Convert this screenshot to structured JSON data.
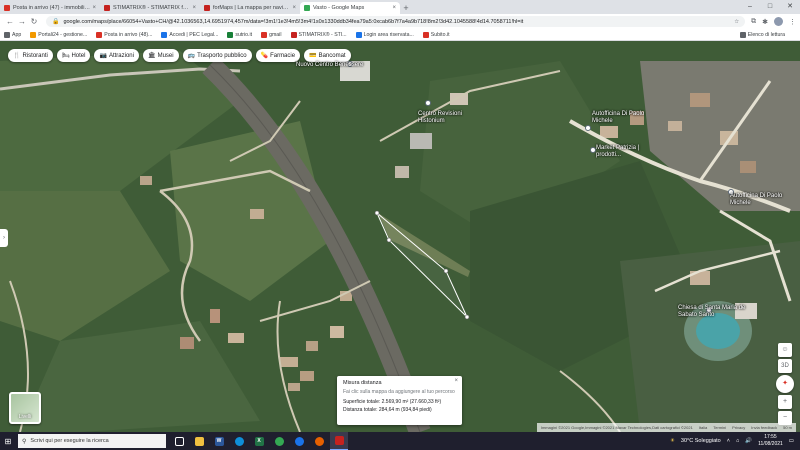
{
  "browser": {
    "tabs": [
      {
        "title": "Posta in arrivo (47) - immobiliare",
        "color": "#d93025"
      },
      {
        "title": "STIMATRIX® - STIMATRIX forMaps",
        "color": "#c5221f"
      },
      {
        "title": "forMaps | La mappa per navigare",
        "color": "#c5221f"
      },
      {
        "title": "Vasto - Google Maps",
        "color": "#34a853",
        "active": true
      }
    ],
    "new_tab": "+",
    "url": "google.com/maps/place/66054+Vasto+CH/@42.1036563,14.6951974,457m/data=!3m1!1e3!4m5!3m4!1s0x1330ddb34fea79a5:0xcab6b7f7a4a9b718!8m2!3d42.1045588!4d14.7058711!hl=it",
    "bookmarks": [
      {
        "label": "App",
        "color": "#5f6368"
      },
      {
        "label": "Portali24 - gestione...",
        "color": "#f29900"
      },
      {
        "label": "Posta in arrivo (48)...",
        "color": "#d93025"
      },
      {
        "label": "Accedi | PEC Legal...",
        "color": "#1a73e8"
      },
      {
        "label": "sutrio.it",
        "color": "#188038"
      },
      {
        "label": "gmail",
        "color": "#d93025"
      },
      {
        "label": "STIMATRIX® - STI...",
        "color": "#c5221f"
      },
      {
        "label": "Login area riservata...",
        "color": "#1a73e8"
      },
      {
        "label": "Subito.it",
        "color": "#d93025"
      }
    ],
    "reading_list": "Elenco di lettura"
  },
  "map": {
    "chips": [
      {
        "icon": "fork-knife-icon",
        "glyph": "🍴",
        "label": "Ristoranti"
      },
      {
        "icon": "bed-icon",
        "glyph": "🛏",
        "label": "Hotel"
      },
      {
        "icon": "camera-icon",
        "glyph": "📷",
        "label": "Attrazioni"
      },
      {
        "icon": "museum-icon",
        "glyph": "🏛",
        "label": "Musei"
      },
      {
        "icon": "bus-icon",
        "glyph": "🚌",
        "label": "Trasporto pubblico"
      },
      {
        "icon": "pill-icon",
        "glyph": "💊",
        "label": "Farmacie"
      },
      {
        "icon": "atm-icon",
        "glyph": "💳",
        "label": "Bancomat"
      }
    ],
    "places": [
      {
        "label": "Nuovo Centro Benessere"
      },
      {
        "label": "Centro Revisioni Histonium"
      },
      {
        "label": "Autofficina Di Paolo Michele"
      },
      {
        "label": "Market Patrizia | prodotti..."
      },
      {
        "label": "Autofficina Di Paolo Michele"
      },
      {
        "label": "Chiesa di Santa Maria de Sabato Santo"
      }
    ],
    "layers_label": "Livelli",
    "measure": {
      "title": "Misura distanza",
      "hint": "Fai clic sulla mappa da aggiungere al tuo percorso",
      "area": "Superficie totale: 2.569,90 m² (27.660,33 ft²)",
      "distance": "Distanza totale: 284,64 m (934,84 piedi)"
    },
    "attribution": [
      "Immagini ©2021 Google,Immagini ©2021 Maxar Technologies,Dati cartografici ©2021",
      "Italia",
      "Termini",
      "Privacy",
      "Invia feedback",
      "50 m"
    ]
  },
  "taskbar": {
    "search_placeholder": "Scrivi qui per eseguire la ricerca",
    "weather": "30°C  Soleggiato",
    "time": "17:55",
    "date": "11/08/2021"
  }
}
